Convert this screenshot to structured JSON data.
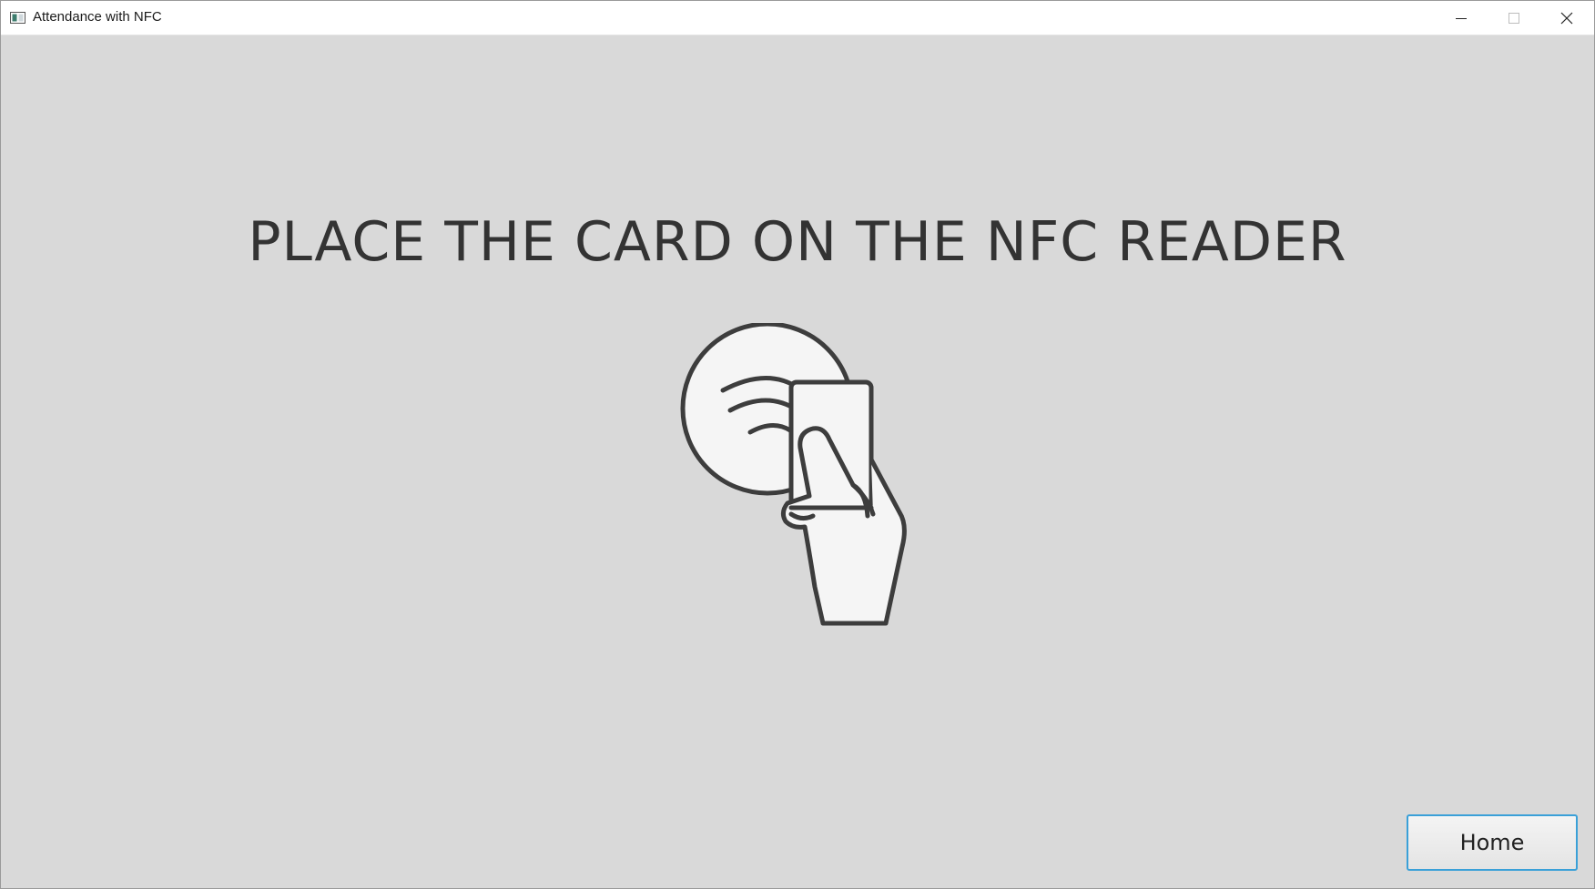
{
  "window": {
    "title": "Attendance with NFC",
    "icons": {
      "app": "app-window-icon",
      "minimize": "minimize-icon",
      "maximize": "maximize-icon",
      "close": "close-icon"
    }
  },
  "main": {
    "prompt": "PLACE THE CARD ON THE NFC READER",
    "illustration": "nfc-card-tap-icon"
  },
  "footer": {
    "home_label": "Home"
  },
  "colors": {
    "background": "#d9d9d9",
    "text": "#333333",
    "accent_border": "#3aa0d8",
    "illustration_stroke": "#3d3d3d",
    "illustration_fill": "#f5f5f5"
  }
}
